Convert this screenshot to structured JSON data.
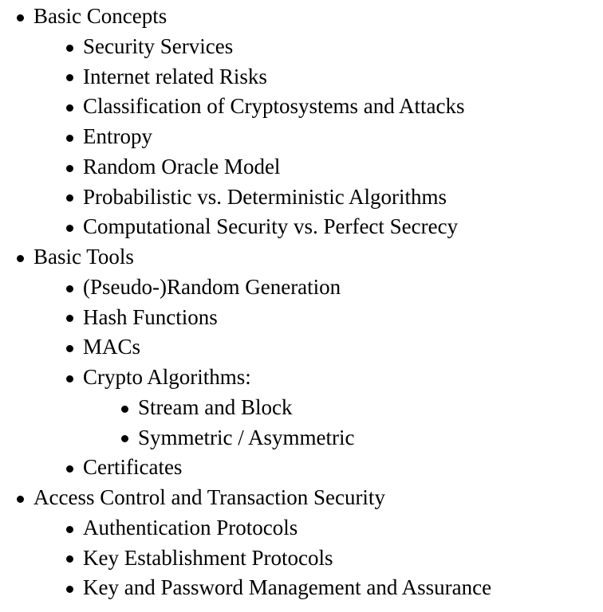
{
  "outline": [
    {
      "level": 1,
      "text": "Basic Concepts"
    },
    {
      "level": 2,
      "text": "Security Services"
    },
    {
      "level": 2,
      "text": "Internet related Risks"
    },
    {
      "level": 2,
      "text": "Classification of Cryptosystems and Attacks"
    },
    {
      "level": 2,
      "text": "Entropy"
    },
    {
      "level": 2,
      "text": "Random Oracle Model"
    },
    {
      "level": 2,
      "text": "Probabilistic vs. Deterministic Algorithms"
    },
    {
      "level": 2,
      "text": "Computational Security vs. Perfect Secrecy"
    },
    {
      "level": 1,
      "text": "Basic Tools"
    },
    {
      "level": 2,
      "text": "(Pseudo-)Random Generation"
    },
    {
      "level": 2,
      "text": "Hash Functions"
    },
    {
      "level": 2,
      "text": "MACs"
    },
    {
      "level": 2,
      "text": "Crypto Algorithms:"
    },
    {
      "level": 3,
      "text": "Stream and Block"
    },
    {
      "level": 3,
      "text": "Symmetric / Asymmetric"
    },
    {
      "level": 2,
      "text": "Certificates"
    },
    {
      "level": 1,
      "text": "Access Control and Transaction Security"
    },
    {
      "level": 2,
      "text": "Authentication Protocols"
    },
    {
      "level": 2,
      "text": "Key Establishment Protocols"
    },
    {
      "level": 2,
      "text": "Key and Password Management and Assurance"
    }
  ]
}
